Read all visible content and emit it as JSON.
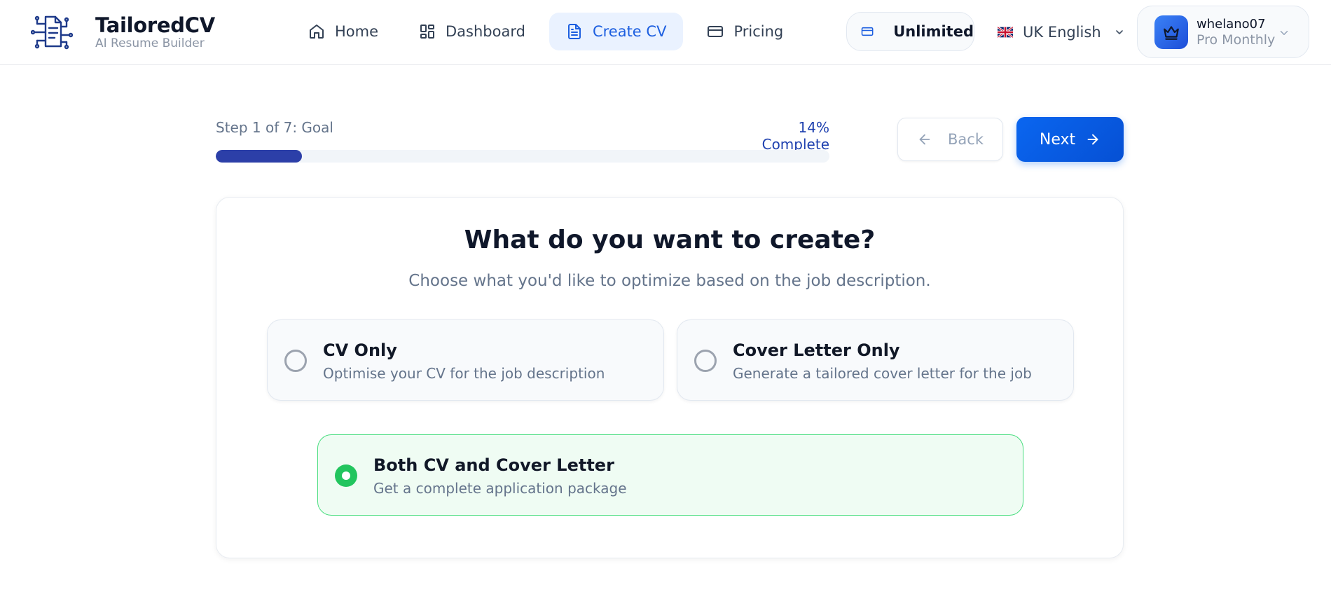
{
  "brand": {
    "name": "TailoredCV",
    "tagline": "AI Resume Builder"
  },
  "nav": [
    {
      "label": "Home",
      "icon": "home-icon"
    },
    {
      "label": "Dashboard",
      "icon": "dashboard-icon"
    },
    {
      "label": "Create CV",
      "icon": "document-icon",
      "active": true
    },
    {
      "label": "Pricing",
      "icon": "card-icon"
    }
  ],
  "plan_badge": {
    "label": "Unlimited",
    "icon": "card-icon"
  },
  "language": {
    "label": "UK English",
    "icon": "uk-flag-icon"
  },
  "user": {
    "name": "whelano07",
    "plan": "Pro Monthly",
    "icon": "crown-icon"
  },
  "progress": {
    "step_label": "Step 1 of 7: Goal",
    "percent_label": "14% Complete",
    "fraction": 0.14
  },
  "actions": {
    "back_label": "Back",
    "next_label": "Next"
  },
  "question": {
    "title": "What do you want to create?",
    "subtitle": "Choose what you'd like to optimize based on the job description."
  },
  "options": [
    {
      "title": "CV Only",
      "description": "Optimise your CV for the job description",
      "selected": false
    },
    {
      "title": "Cover Letter Only",
      "description": "Generate a tailored cover letter for the job",
      "selected": false
    },
    {
      "title": "Both CV and Cover Letter",
      "description": "Get a complete application package",
      "selected": true
    }
  ],
  "colors": {
    "primary": "#0a66f0",
    "progress": "#2c3fa8",
    "active_nav_bg": "#eaf2ff",
    "selected_border": "#4ade80",
    "selected_bg": "#effcf3",
    "radio_on": "#22c55e"
  }
}
